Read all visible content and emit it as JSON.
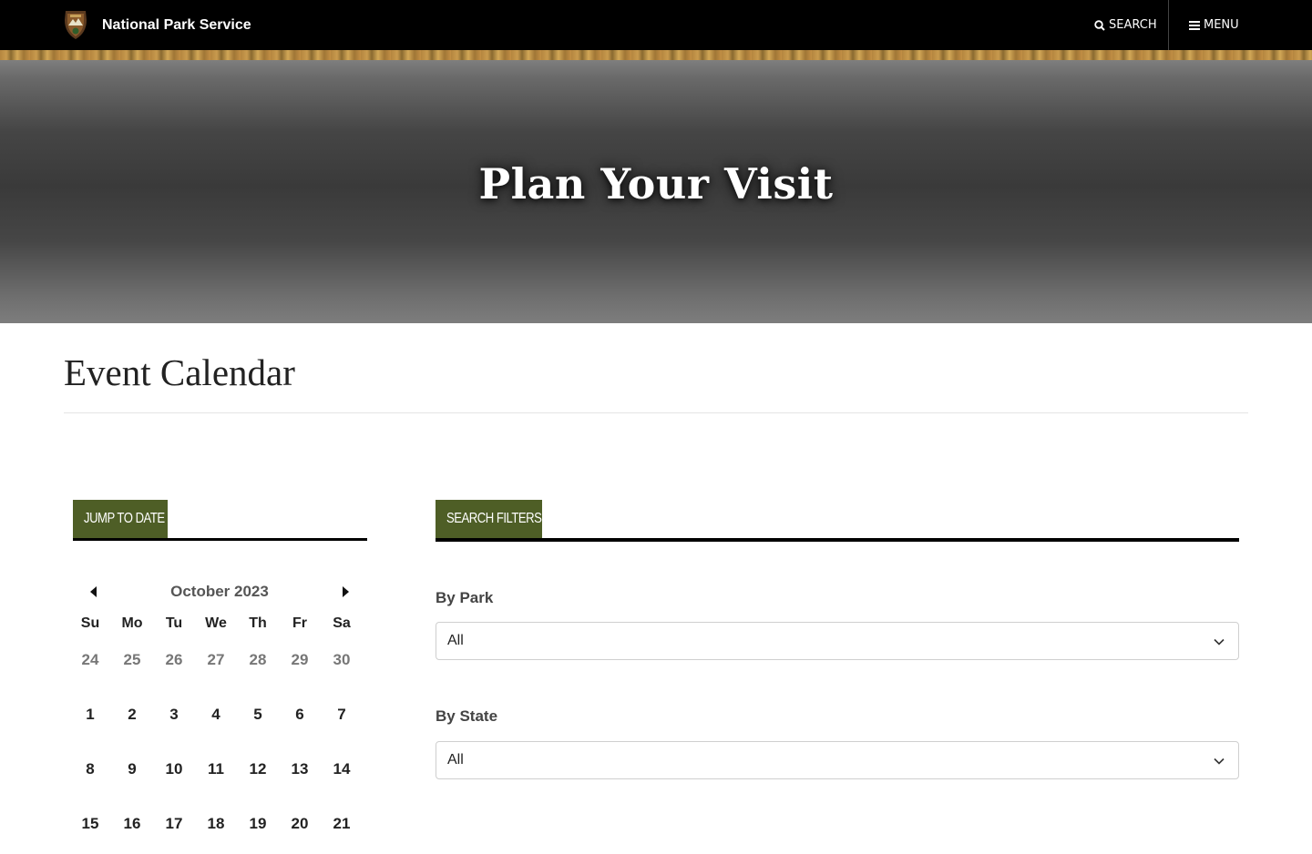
{
  "header": {
    "site_name": "National Park Service",
    "search_label": "SEARCH",
    "menu_label": "MENU"
  },
  "hero": {
    "title": "Plan Your Visit"
  },
  "page": {
    "title": "Event Calendar"
  },
  "jump_to_date": {
    "tab_label": "JUMP TO DATE",
    "month_label": "October 2023",
    "weekdays": [
      "Su",
      "Mo",
      "Tu",
      "We",
      "Th",
      "Fr",
      "Sa"
    ],
    "weeks": [
      [
        "24",
        "25",
        "26",
        "27",
        "28",
        "29",
        "30"
      ],
      [
        "1",
        "2",
        "3",
        "4",
        "5",
        "6",
        "7"
      ],
      [
        "8",
        "9",
        "10",
        "11",
        "12",
        "13",
        "14"
      ],
      [
        "15",
        "16",
        "17",
        "18",
        "19",
        "20",
        "21"
      ]
    ]
  },
  "search_filters": {
    "tab_label": "SEARCH FILTERS",
    "by_park": {
      "label": "By Park",
      "value": "All"
    },
    "by_state": {
      "label": "By State",
      "value": "All"
    }
  },
  "colors": {
    "tab_green": "#4e5e26",
    "header_black": "#000000",
    "muted_day": "#777777"
  },
  "icons": [
    "nps-arrowhead-logo",
    "search-icon",
    "menu-icon",
    "caret-left-icon",
    "caret-right-icon",
    "chevron-down-icon"
  ]
}
